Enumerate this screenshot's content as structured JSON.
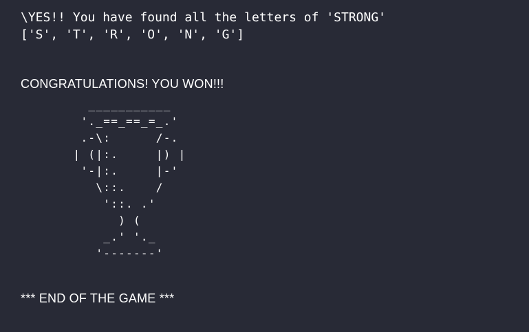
{
  "terminal": {
    "found_message": "\\YES!! You have found all the letters of 'STRONG'",
    "letters_list": "['S', 'T', 'R', 'O', 'N', 'G']",
    "congrats": "CONGRATULATIONS! YOU WON!!!",
    "trophy_art": "         ___________\n        '._==_==_=_.'\n        .-\\:      /-.\n       | (|:.     |) |\n        '-|:.     |-'\n          \\::.    /\n           '::. .'\n             ) (\n           _.' '._\n          '-------'",
    "end_message": "*** END OF THE GAME ***"
  },
  "colors": {
    "background": "#282a36",
    "text": "#ffffff"
  }
}
